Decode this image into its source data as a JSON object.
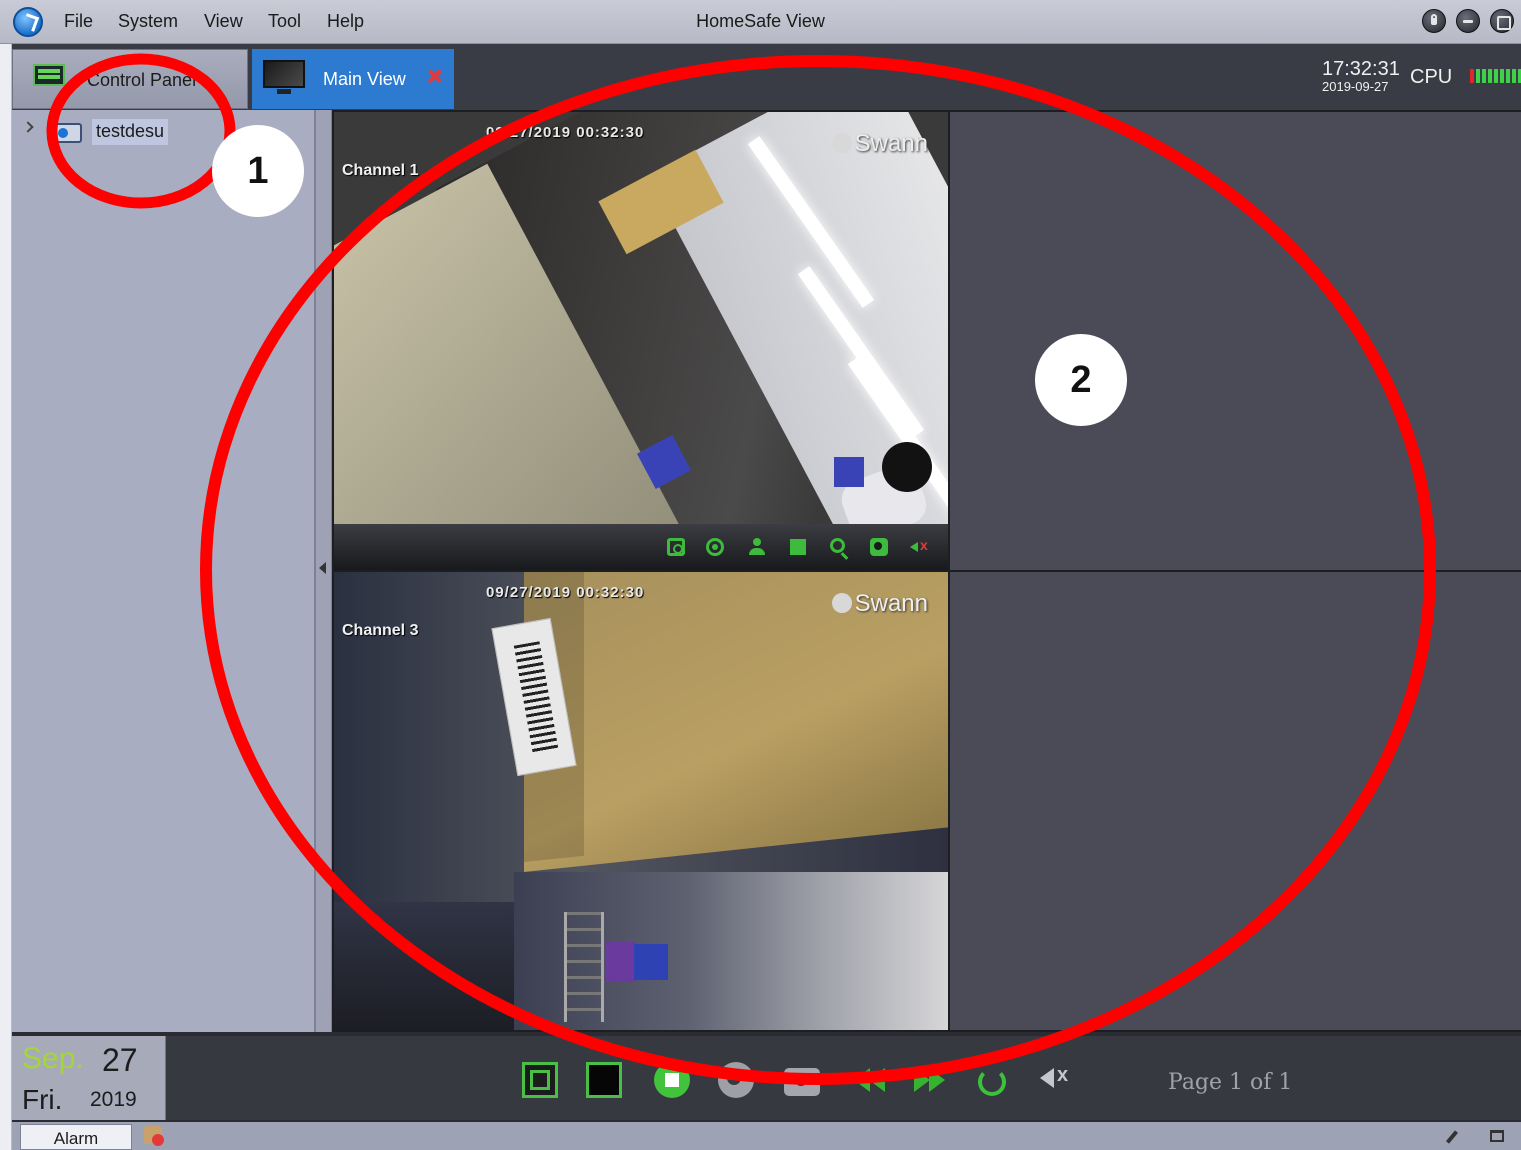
{
  "menu": {
    "items": [
      {
        "label": "File"
      },
      {
        "label": "System"
      },
      {
        "label": "View"
      },
      {
        "label": "Tool"
      },
      {
        "label": "Help"
      }
    ],
    "window_title": "HomeSafe View"
  },
  "window_controls": {
    "lock_icon": "lock-icon",
    "minimize_icon": "minimize-icon",
    "maximize_icon": "maximize-icon"
  },
  "tabs": [
    {
      "label": "Control Panel",
      "icon": "control-panel-icon",
      "active": false
    },
    {
      "label": "Main View",
      "icon": "monitor-icon",
      "active": true
    }
  ],
  "status": {
    "time": "17:32:31",
    "date": "2019-09-27",
    "cpu_label": "CPU",
    "cpu_level": 0.9
  },
  "device_tree": {
    "items": [
      {
        "label": "testdesu",
        "icon": "dvr-device-icon"
      }
    ]
  },
  "video_grid": {
    "cells": [
      {
        "timestamp": "09/27/2019 00:32:30",
        "brand": "Swann",
        "channel": "Channel 1"
      },
      {
        "timestamp": "",
        "brand": "",
        "channel": ""
      },
      {
        "timestamp": "09/27/2019 00:32:30",
        "brand": "Swann",
        "channel": "Channel 3"
      },
      {
        "timestamp": "",
        "brand": "",
        "channel": ""
      }
    ],
    "cell_toolbar": [
      "snapshot-icon",
      "record-icon",
      "ptz-icon",
      "stop-icon",
      "zoom-icon",
      "video-capture-icon",
      "mute-icon"
    ]
  },
  "date_panel": {
    "month": "Sep.",
    "day": "27",
    "weekday": "Fri.",
    "year": "2019"
  },
  "playback_controls": [
    "fullscreen-icon",
    "single-view-icon",
    "stop-all-icon",
    "record-all-icon",
    "snapshot-all-icon",
    "previous-page-icon",
    "next-page-icon",
    "refresh-icon",
    "volume-mute-icon"
  ],
  "page_indicator": "Page 1 of 1",
  "statusbar": {
    "alarm_label": "Alarm"
  },
  "annotations": [
    {
      "label": "1"
    },
    {
      "label": "2"
    }
  ],
  "colors": {
    "accent": "#2d7bd0",
    "annotation_red": "#ff0000",
    "control_green": "#3dbb3d",
    "month_green": "#a4d63a"
  }
}
